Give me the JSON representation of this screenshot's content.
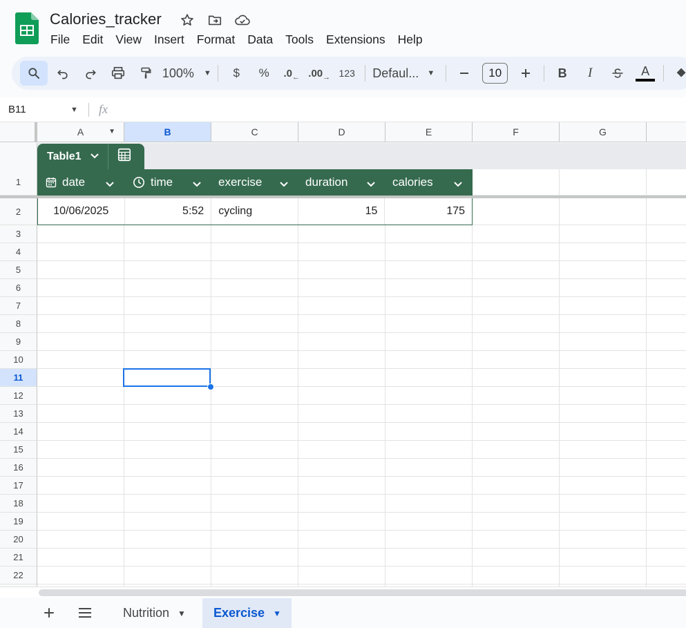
{
  "app": {
    "title": "Calories_tracker",
    "menu": [
      "File",
      "Edit",
      "View",
      "Insert",
      "Format",
      "Data",
      "Tools",
      "Extensions",
      "Help"
    ]
  },
  "toolbar": {
    "zoom": "100%",
    "currency": "$",
    "percent": "%",
    "decrease_decimal": ".0",
    "increase_decimal": ".00",
    "number_format": "123",
    "font_name": "Defaul...",
    "font_size": "10",
    "bold": "B",
    "italic": "I",
    "text_color": "A"
  },
  "formula_bar": {
    "name_box": "B11",
    "fx_label": "fx",
    "formula": ""
  },
  "grid": {
    "columns": [
      "A",
      "B",
      "C",
      "D",
      "E",
      "F",
      "G"
    ],
    "selected_column": "B",
    "rows": [
      "1",
      "2",
      "3",
      "4",
      "5",
      "6",
      "7",
      "8",
      "9",
      "10",
      "11",
      "12",
      "13",
      "14",
      "15",
      "16",
      "17",
      "18",
      "19",
      "20",
      "21",
      "22"
    ],
    "selected_row": "11",
    "active_cell": "B11"
  },
  "table": {
    "name": "Table1",
    "headers": [
      {
        "label": "date",
        "icon": "calendar-icon"
      },
      {
        "label": "time",
        "icon": "clock-icon"
      },
      {
        "label": "exercise",
        "icon": ""
      },
      {
        "label": "duration",
        "icon": ""
      },
      {
        "label": "calories",
        "icon": ""
      }
    ],
    "rows": [
      [
        "10/06/2025",
        "5:52",
        "cycling",
        "15",
        "175"
      ]
    ],
    "header_color": "#356a4e"
  },
  "sheets": {
    "tabs": [
      {
        "label": "Nutrition",
        "active": false
      },
      {
        "label": "Exercise",
        "active": true
      }
    ]
  },
  "colors": {
    "accent": "#0b57d0",
    "selection": "#1a73e8",
    "table_green": "#356a4e"
  }
}
